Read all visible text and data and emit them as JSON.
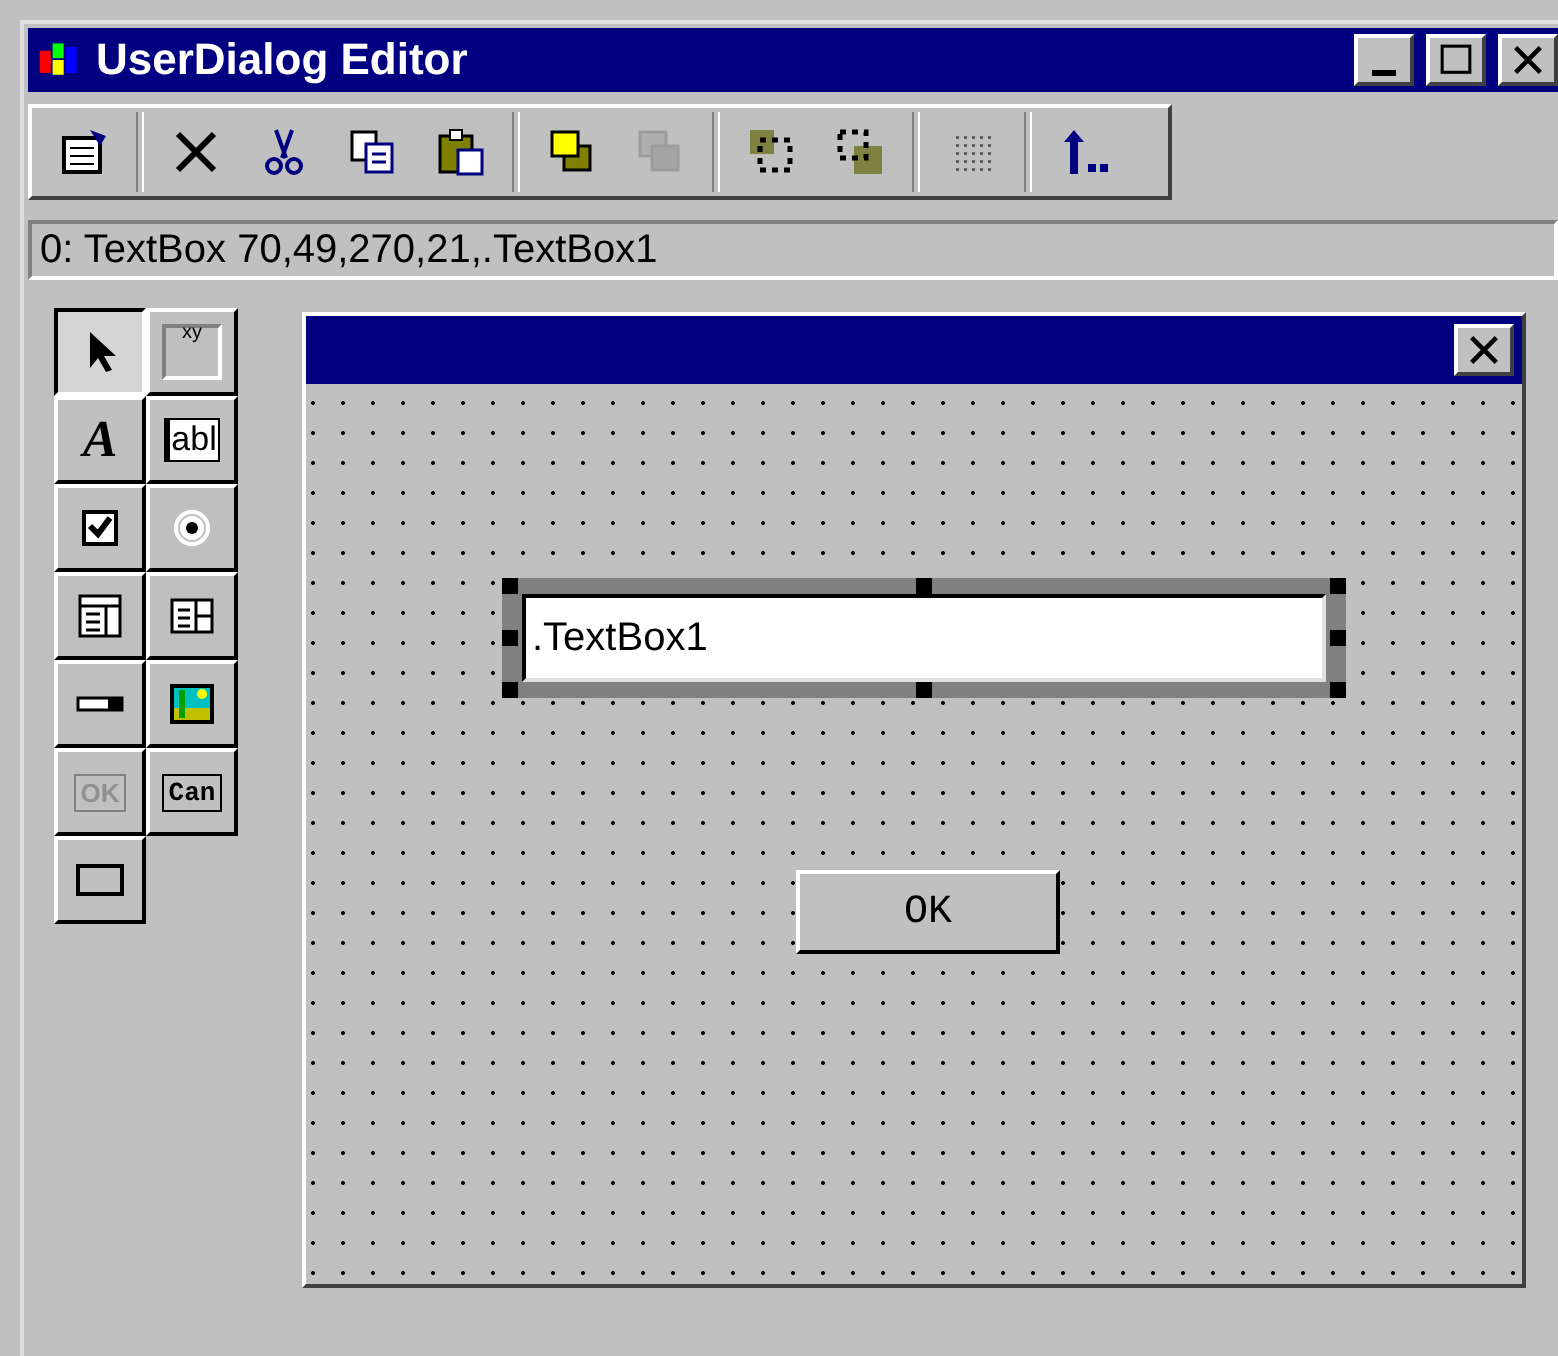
{
  "window": {
    "title": "UserDialog Editor"
  },
  "toolbar": [
    [
      {
        "kind": "properties",
        "disabled": false
      }
    ],
    [
      {
        "kind": "delete",
        "disabled": false
      },
      {
        "kind": "cut",
        "disabled": false
      },
      {
        "kind": "copy",
        "disabled": false
      },
      {
        "kind": "paste",
        "disabled": false
      }
    ],
    [
      {
        "kind": "front",
        "disabled": false
      },
      {
        "kind": "back",
        "disabled": true
      }
    ],
    [
      {
        "kind": "group",
        "disabled": false
      },
      {
        "kind": "ungroup",
        "disabled": false
      }
    ],
    [
      {
        "kind": "grid",
        "disabled": false
      }
    ],
    [
      {
        "kind": "goto",
        "disabled": false
      }
    ]
  ],
  "status": "0: TextBox 70,49,270,21,.TextBox1",
  "palette": [
    {
      "kind": "pointer",
      "selected": true
    },
    {
      "kind": "groupbox",
      "glyph": "xy",
      "selected": false
    },
    {
      "kind": "text",
      "glyph": "A",
      "selected": false
    },
    {
      "kind": "textbox",
      "glyph": "abl",
      "selected": false
    },
    {
      "kind": "checkbox",
      "selected": false
    },
    {
      "kind": "option",
      "selected": false
    },
    {
      "kind": "droplist",
      "selected": false
    },
    {
      "kind": "listbox",
      "selected": false
    },
    {
      "kind": "combo",
      "selected": false
    },
    {
      "kind": "picture",
      "selected": false
    },
    {
      "kind": "okbutton",
      "glyph": "OK",
      "selected": false
    },
    {
      "kind": "cancelbutton",
      "glyph": "Can",
      "selected": false
    },
    {
      "kind": "pushbutton",
      "selected": false
    }
  ],
  "dialog": {
    "controls": [
      {
        "kind": "textbox",
        "value": ".TextBox1",
        "selected": true
      },
      {
        "kind": "button",
        "label": "OK",
        "selected": false
      }
    ]
  }
}
